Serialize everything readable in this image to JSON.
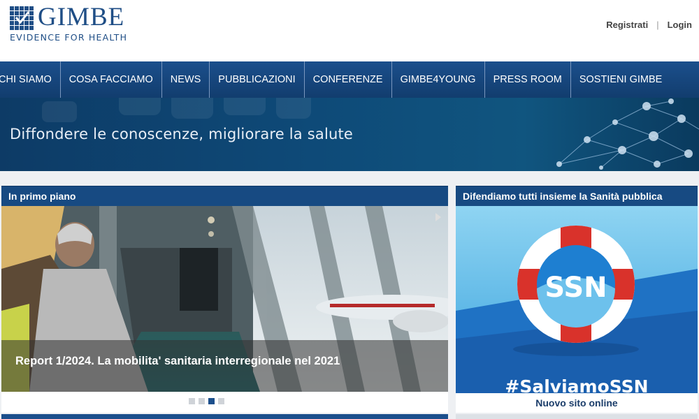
{
  "header": {
    "brand_name": "GIMBE",
    "brand_tagline": "EVIDENCE FOR HEALTH",
    "register_label": "Registrati",
    "separator": "|",
    "login_label": "Login"
  },
  "nav": {
    "items": [
      {
        "label": "CHI SIAMO"
      },
      {
        "label": "COSA FACCIAMO"
      },
      {
        "label": "NEWS"
      },
      {
        "label": "PUBBLICAZIONI"
      },
      {
        "label": "CONFERENZE"
      },
      {
        "label": "GIMBE4YOUNG"
      },
      {
        "label": "PRESS ROOM"
      },
      {
        "label": "SOSTIENI GIMBE"
      }
    ]
  },
  "banner": {
    "slogan": "Diffondere le conoscenze, migliorare la salute"
  },
  "featured": {
    "title": "In primo piano",
    "slide_caption": "Report 1/2024. La mobilita' sanitaria interregionale nel 2021",
    "slide_count": 4,
    "active_slide": 3
  },
  "campaign": {
    "title": "Difendiamo tutti insieme la Sanità pubblica",
    "lifebuoy_label": "SSN",
    "hashtag": "#SalviamoSSN",
    "footer_link": "Nuovo sito online"
  },
  "colors": {
    "brand_blue": "#1b4f8c",
    "header_bar": "#174a82",
    "lifebuoy_red": "#d9322b"
  }
}
